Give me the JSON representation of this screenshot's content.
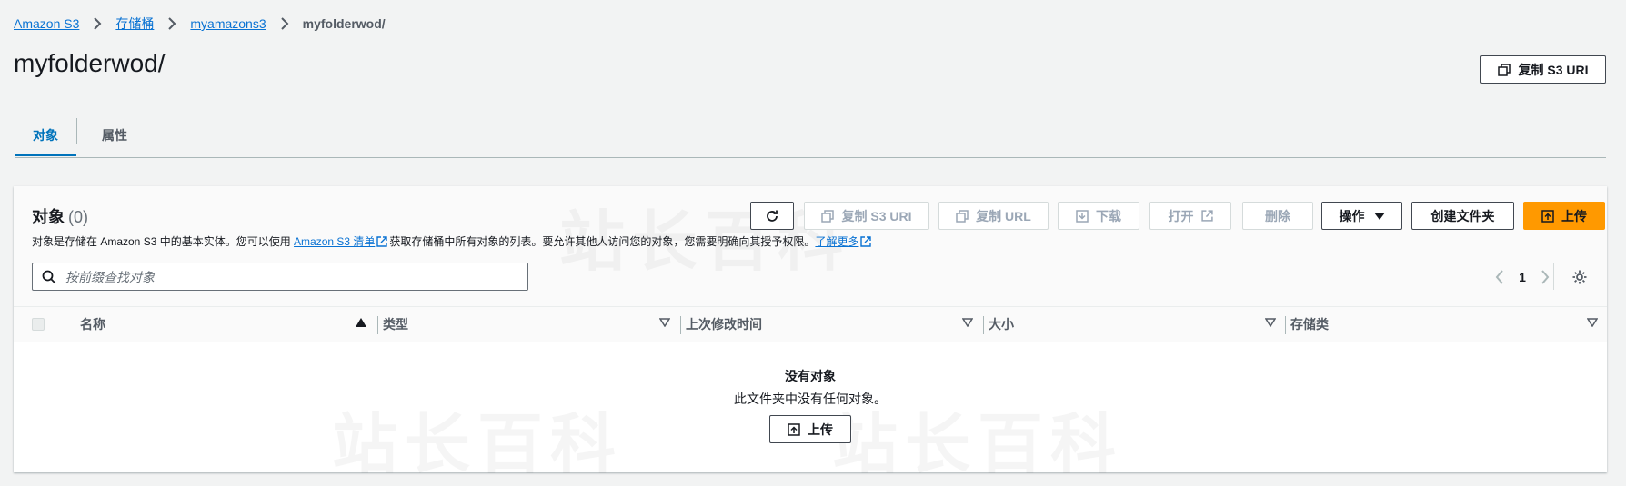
{
  "breadcrumb": {
    "items": [
      "Amazon S3",
      "存储桶",
      "myamazons3"
    ],
    "current": "myfolderwod/"
  },
  "page": {
    "title": "myfolderwod/",
    "copy_uri_label": "复制 S3 URI"
  },
  "tabs": [
    {
      "label": "对象",
      "active": true
    },
    {
      "label": "属性",
      "active": false
    }
  ],
  "objects_panel": {
    "title": "对象",
    "count": "(0)",
    "description_pre": "对象是存储在 Amazon S3 中的基本实体。您可以使用 ",
    "inventory_link": "Amazon S3 清单",
    "description_mid": "获取存储桶中所有对象的列表。要允许其他人访问您的对象，您需要明确向其授予权限。",
    "learn_more": "了解更多",
    "toolbar": {
      "copy_uri": "复制 S3 URI",
      "copy_url": "复制 URL",
      "download": "下载",
      "open": "打开",
      "delete": "删除",
      "actions": "操作",
      "create_folder": "创建文件夹",
      "upload": "上传"
    },
    "search_placeholder": "按前缀查找对象",
    "pagination": {
      "current_page": "1"
    },
    "columns": [
      "名称",
      "类型",
      "上次修改时间",
      "大小",
      "存储类"
    ],
    "empty": {
      "title": "没有对象",
      "description": "此文件夹中没有任何对象。",
      "upload_label": "上传"
    }
  },
  "watermarks": [
    "站长百科",
    "站长百科",
    "站长百科"
  ],
  "colors": {
    "accent": "#0073bb",
    "primary_button": "#ff9900",
    "link": "#0972d3"
  }
}
